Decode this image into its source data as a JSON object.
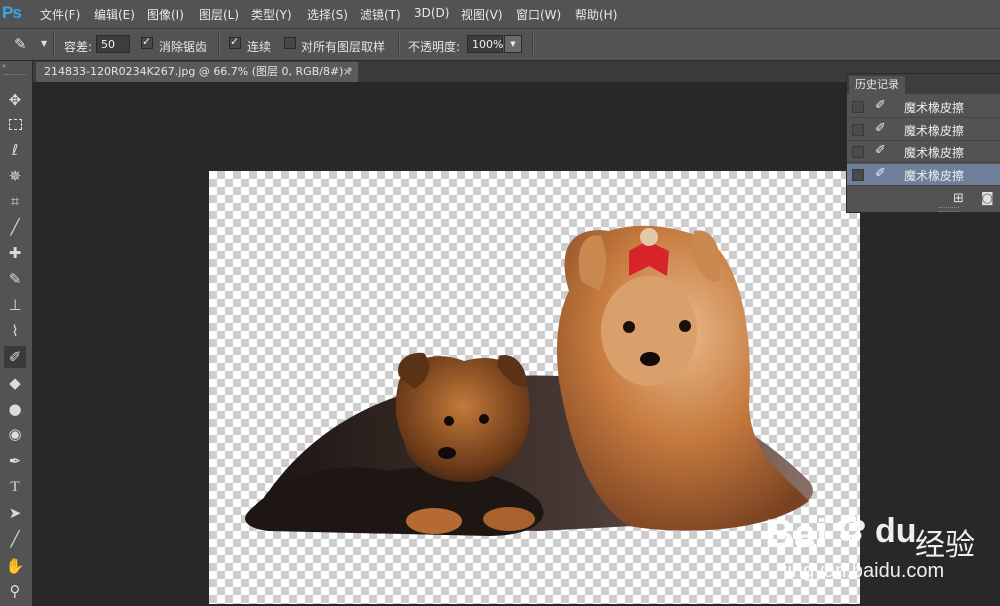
{
  "app": {
    "logo": "Ps"
  },
  "menu": [
    "文件(F)",
    "编辑(E)",
    "图像(I)",
    "图层(L)",
    "类型(Y)",
    "选择(S)",
    "滤镜(T)",
    "3D(D)",
    "视图(V)",
    "窗口(W)",
    "帮助(H)"
  ],
  "options": {
    "tolerance_label": "容差:",
    "tolerance_value": "50",
    "antialias_label": "消除锯齿",
    "antialias_checked": true,
    "contiguous_label": "连续",
    "contiguous_checked": true,
    "all_layers_label": "对所有图层取样",
    "all_layers_checked": false,
    "opacity_label": "不透明度:",
    "opacity_value": "100%"
  },
  "document": {
    "tab_title": "214833-120R0234K267.jpg @ 66.7% (图层 0, RGB/8#) *",
    "close": "×"
  },
  "tools": [
    "move-icon",
    "marquee-icon",
    "lasso-icon",
    "magic-wand-icon",
    "crop-icon",
    "eyedropper-icon",
    "healing-brush-icon",
    "brush-icon",
    "clone-stamp-icon",
    "history-brush-icon",
    "magic-eraser-icon",
    "paint-bucket-icon",
    "blur-icon",
    "dodge-icon",
    "pen-icon",
    "type-icon",
    "path-selection-icon",
    "line-icon",
    "hand-icon",
    "zoom-icon"
  ],
  "history": {
    "tab": "历史记录",
    "items": [
      {
        "label": "魔术橡皮擦",
        "selected": false
      },
      {
        "label": "魔术橡皮擦",
        "selected": false
      },
      {
        "label": "魔术橡皮擦",
        "selected": false
      },
      {
        "label": "魔术橡皮擦",
        "selected": true
      }
    ]
  },
  "watermark": {
    "brand": "Bai",
    "brand2": "du",
    "suffix": "经验",
    "url": "jingyan.baidu.com"
  },
  "colors": {
    "accent": "#3ea2ea",
    "selection": "#6e7f99",
    "panel": "#535353",
    "workspace": "#282828"
  }
}
